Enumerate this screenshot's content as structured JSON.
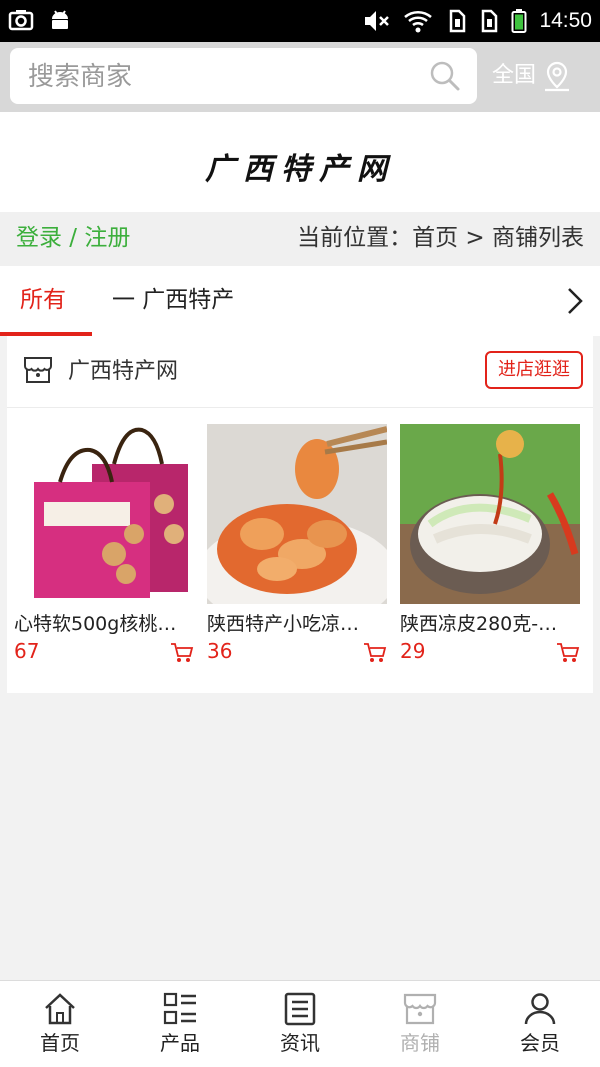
{
  "status_bar": {
    "time": "14:50",
    "left_icons": [
      "screenshot-icon",
      "android-icon"
    ],
    "right_icons": [
      "mute-icon",
      "wifi-icon",
      "sim1-icon",
      "sim2-icon",
      "battery-icon"
    ]
  },
  "search": {
    "placeholder": "搜索商家",
    "region_label": "全国"
  },
  "logo": {
    "text": "广西特产网"
  },
  "breadcrumb": {
    "login": "登录 / 注册",
    "location": "当前位置：首页 > 商铺列表"
  },
  "categories": {
    "active": "所有",
    "items": [
      "一 广西特产"
    ]
  },
  "store": {
    "name": "广西特产网",
    "visit_label": "进店逛逛",
    "products": [
      {
        "title": "心特软500g核桃…",
        "price": "67"
      },
      {
        "title": "陕西特产小吃凉…",
        "price": "36"
      },
      {
        "title": "陕西凉皮280克-…",
        "price": "29"
      }
    ]
  },
  "nav": {
    "items": [
      {
        "label": "首页",
        "icon": "home-icon"
      },
      {
        "label": "产品",
        "icon": "grid-list-icon"
      },
      {
        "label": "资讯",
        "icon": "news-icon"
      },
      {
        "label": "商铺",
        "icon": "shop-icon",
        "active": true
      },
      {
        "label": "会员",
        "icon": "user-icon"
      }
    ]
  },
  "colors": {
    "accent_red": "#e2231a",
    "login_green": "#3caf3c",
    "search_bar_bg": "#d8d8d8"
  }
}
